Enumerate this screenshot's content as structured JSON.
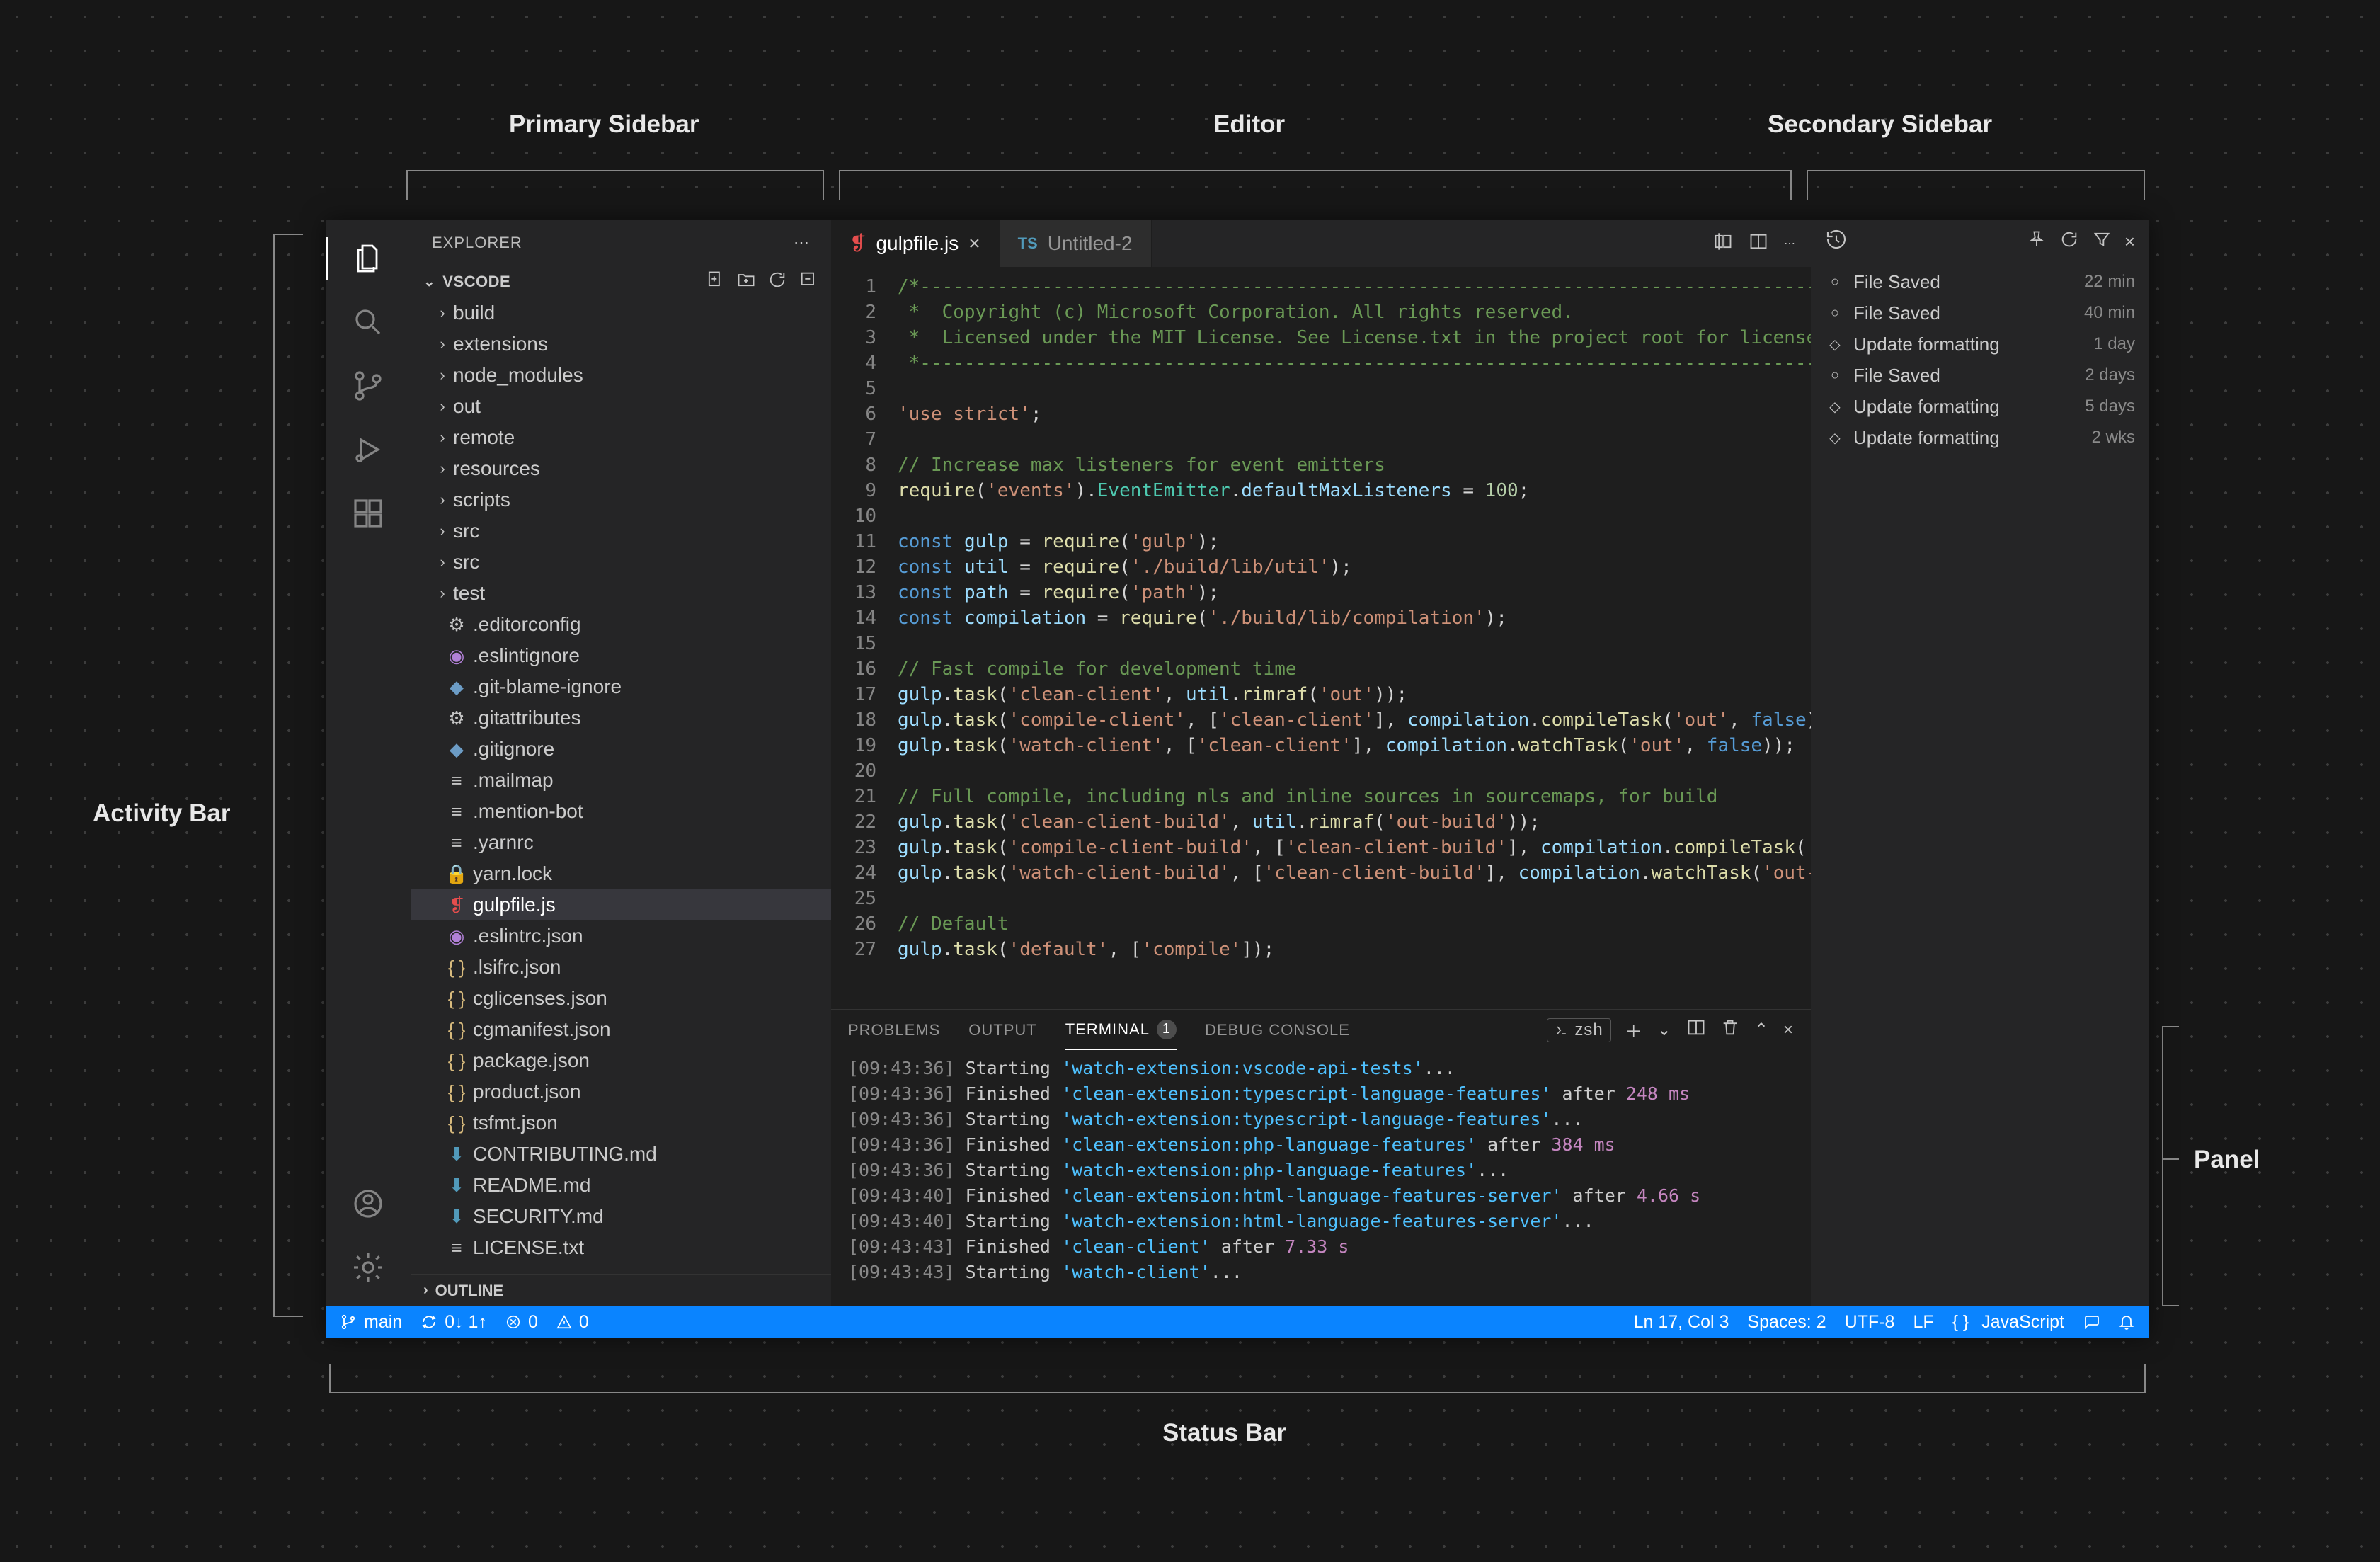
{
  "labels": {
    "primary": "Primary Sidebar",
    "editor": "Editor",
    "secondary": "Secondary Sidebar",
    "activity": "Activity Bar",
    "panel": "Panel",
    "status": "Status Bar"
  },
  "explorer": {
    "title": "EXPLORER",
    "project": "VSCODE",
    "folders": [
      "build",
      "extensions",
      "node_modules",
      "out",
      "remote",
      "resources",
      "scripts",
      "src",
      "src",
      "test"
    ],
    "files": [
      {
        "name": ".editorconfig",
        "icon": "gear",
        "color": "#c5c5c5"
      },
      {
        "name": ".eslintignore",
        "icon": "eye",
        "color": "#b180d7"
      },
      {
        "name": ".git-blame-ignore",
        "icon": "diamond",
        "color": "#6c9cc5"
      },
      {
        "name": ".gitattributes",
        "icon": "gear",
        "color": "#c5c5c5"
      },
      {
        "name": ".gitignore",
        "icon": "diamond",
        "color": "#6c9cc5"
      },
      {
        "name": ".mailmap",
        "icon": "lines",
        "color": "#c5c5c5"
      },
      {
        "name": ".mention-bot",
        "icon": "lines",
        "color": "#c5c5c5"
      },
      {
        "name": ".yarnrc",
        "icon": "lines",
        "color": "#c5c5c5"
      },
      {
        "name": "yarn.lock",
        "icon": "lock",
        "color": "#6c9cc5"
      },
      {
        "name": "gulpfile.js",
        "icon": "gulp",
        "color": "#e44d4d",
        "selected": true
      },
      {
        "name": ".eslintrc.json",
        "icon": "eye",
        "color": "#b180d7"
      },
      {
        "name": ".lsifrc.json",
        "icon": "braces",
        "color": "#d7ba7d"
      },
      {
        "name": "cglicenses.json",
        "icon": "braces",
        "color": "#d7ba7d"
      },
      {
        "name": "cgmanifest.json",
        "icon": "braces",
        "color": "#d7ba7d"
      },
      {
        "name": "package.json",
        "icon": "braces",
        "color": "#d7ba7d"
      },
      {
        "name": "product.json",
        "icon": "braces",
        "color": "#d7ba7d"
      },
      {
        "name": "tsfmt.json",
        "icon": "braces",
        "color": "#d7ba7d"
      },
      {
        "name": "CONTRIBUTING.md",
        "icon": "md",
        "color": "#519aba"
      },
      {
        "name": "README.md",
        "icon": "md",
        "color": "#519aba"
      },
      {
        "name": "SECURITY.md",
        "icon": "md",
        "color": "#519aba"
      },
      {
        "name": "LICENSE.txt",
        "icon": "lines",
        "color": "#c5c5c5"
      }
    ],
    "outline": "OUTLINE"
  },
  "tabs": {
    "active": {
      "name": "gulpfile.js",
      "icon": "gulp"
    },
    "inactive": {
      "name": "Untitled-2",
      "prefix": "TS"
    }
  },
  "code_lines": [
    {
      "html": "<span class='c-comment'>/*---------------------------------------------------------------------------------------------</span>"
    },
    {
      "html": "<span class='c-comment'> *  Copyright (c) Microsoft Corporation. All rights reserved.</span>"
    },
    {
      "html": "<span class='c-comment'> *  Licensed under the MIT License. See License.txt in the project root for license</span>"
    },
    {
      "html": "<span class='c-comment'> *--------------------------------------------------------------------------------------------*/</span>"
    },
    {
      "html": ""
    },
    {
      "html": "<span class='c-string'>'use strict'</span>;"
    },
    {
      "html": ""
    },
    {
      "html": "<span class='c-comment'>// Increase max listeners for event emitters</span>"
    },
    {
      "html": "<span class='c-func'>require</span>(<span class='c-string'>'events'</span>).<span class='c-type'>EventEmitter</span>.<span class='c-var'>defaultMaxListeners</span> = <span class='c-num'>100</span>;"
    },
    {
      "html": ""
    },
    {
      "html": "<span class='c-keyword'>const</span> <span class='c-var'>gulp</span> = <span class='c-func'>require</span>(<span class='c-string'>'gulp'</span>);"
    },
    {
      "html": "<span class='c-keyword'>const</span> <span class='c-var'>util</span> = <span class='c-func'>require</span>(<span class='c-string'>'./build/lib/util'</span>);"
    },
    {
      "html": "<span class='c-keyword'>const</span> <span class='c-var'>path</span> = <span class='c-func'>require</span>(<span class='c-string'>'path'</span>);"
    },
    {
      "html": "<span class='c-keyword'>const</span> <span class='c-var'>compilation</span> = <span class='c-func'>require</span>(<span class='c-string'>'./build/lib/compilation'</span>);"
    },
    {
      "html": ""
    },
    {
      "html": "<span class='c-comment'>// Fast compile for development time</span>"
    },
    {
      "html": "<span class='c-var'>gulp</span>.<span class='c-func'>task</span>(<span class='c-string'>'clean-client'</span>, <span class='c-var'>util</span>.<span class='c-func'>rimraf</span>(<span class='c-string'>'out'</span>));"
    },
    {
      "html": "<span class='c-var'>gulp</span>.<span class='c-func'>task</span>(<span class='c-string'>'compile-client'</span>, [<span class='c-string'>'clean-client'</span>], <span class='c-var'>compilation</span>.<span class='c-func'>compileTask</span>(<span class='c-string'>'out'</span>, <span class='c-keyword'>false</span>)"
    },
    {
      "html": "<span class='c-var'>gulp</span>.<span class='c-func'>task</span>(<span class='c-string'>'watch-client'</span>, [<span class='c-string'>'clean-client'</span>], <span class='c-var'>compilation</span>.<span class='c-func'>watchTask</span>(<span class='c-string'>'out'</span>, <span class='c-keyword'>false</span>));"
    },
    {
      "html": ""
    },
    {
      "html": "<span class='c-comment'>// Full compile, including nls and inline sources in sourcemaps, for build</span>"
    },
    {
      "html": "<span class='c-var'>gulp</span>.<span class='c-func'>task</span>(<span class='c-string'>'clean-client-build'</span>, <span class='c-var'>util</span>.<span class='c-func'>rimraf</span>(<span class='c-string'>'out-build'</span>));"
    },
    {
      "html": "<span class='c-var'>gulp</span>.<span class='c-func'>task</span>(<span class='c-string'>'compile-client-build'</span>, [<span class='c-string'>'clean-client-build'</span>], <span class='c-var'>compilation</span>.<span class='c-func'>compileTask</span>(<span class='c-string'>'o</span>"
    },
    {
      "html": "<span class='c-var'>gulp</span>.<span class='c-func'>task</span>(<span class='c-string'>'watch-client-build'</span>, [<span class='c-string'>'clean-client-build'</span>], <span class='c-var'>compilation</span>.<span class='c-func'>watchTask</span>(<span class='c-string'>'out-</span>"
    },
    {
      "html": ""
    },
    {
      "html": "<span class='c-comment'>// Default</span>"
    },
    {
      "html": "<span class='c-var'>gulp</span>.<span class='c-func'>task</span>(<span class='c-string'>'default'</span>, [<span class='c-string'>'compile'</span>]);"
    }
  ],
  "panel": {
    "tabs": {
      "problems": "PROBLEMS",
      "output": "OUTPUT",
      "terminal": "TERMINAL",
      "debug": "DEBUG CONSOLE",
      "terminal_badge": "1"
    },
    "shell": "zsh",
    "lines": [
      {
        "time": "[09:43:36]",
        "state": "Starting",
        "task": "'watch-extension:vscode-api-tests'",
        "suffix": "..."
      },
      {
        "time": "[09:43:36]",
        "state": "Finished",
        "task": "'clean-extension:typescript-language-features'",
        "after": " after ",
        "dur": "248 ms"
      },
      {
        "time": "[09:43:36]",
        "state": "Starting",
        "task": "'watch-extension:typescript-language-features'",
        "suffix": "..."
      },
      {
        "time": "[09:43:36]",
        "state": "Finished",
        "task": "'clean-extension:php-language-features'",
        "after": " after ",
        "dur": "384 ms"
      },
      {
        "time": "[09:43:36]",
        "state": "Starting",
        "task": "'watch-extension:php-language-features'",
        "suffix": "..."
      },
      {
        "time": "[09:43:40]",
        "state": "Finished",
        "task": "'clean-extension:html-language-features-server'",
        "after": " after ",
        "dur": "4.66 s"
      },
      {
        "time": "[09:43:40]",
        "state": "Starting",
        "task": "'watch-extension:html-language-features-server'",
        "suffix": "..."
      },
      {
        "time": "[09:43:43]",
        "state": "Finished",
        "task": "'clean-client'",
        "after": " after ",
        "dur": "7.33 s"
      },
      {
        "time": "[09:43:43]",
        "state": "Starting",
        "task": "'watch-client'",
        "suffix": "..."
      }
    ]
  },
  "secondary": {
    "items": [
      {
        "icon": "circle",
        "text": "File Saved",
        "time": "22 min"
      },
      {
        "icon": "circle",
        "text": "File Saved",
        "time": "40 min"
      },
      {
        "icon": "diamond",
        "text": "Update formatting",
        "time": "1 day"
      },
      {
        "icon": "circle",
        "text": "File Saved",
        "time": "2 days"
      },
      {
        "icon": "diamond",
        "text": "Update formatting",
        "time": "5 days"
      },
      {
        "icon": "diamond",
        "text": "Update formatting",
        "time": "2 wks"
      }
    ]
  },
  "status": {
    "branch": "main",
    "sync": "0↓ 1↑",
    "errors": "0",
    "warnings": "0",
    "cursor": "Ln 17, Col 3",
    "spaces": "Spaces: 2",
    "encoding": "UTF-8",
    "eol": "LF",
    "lang": "JavaScript"
  }
}
